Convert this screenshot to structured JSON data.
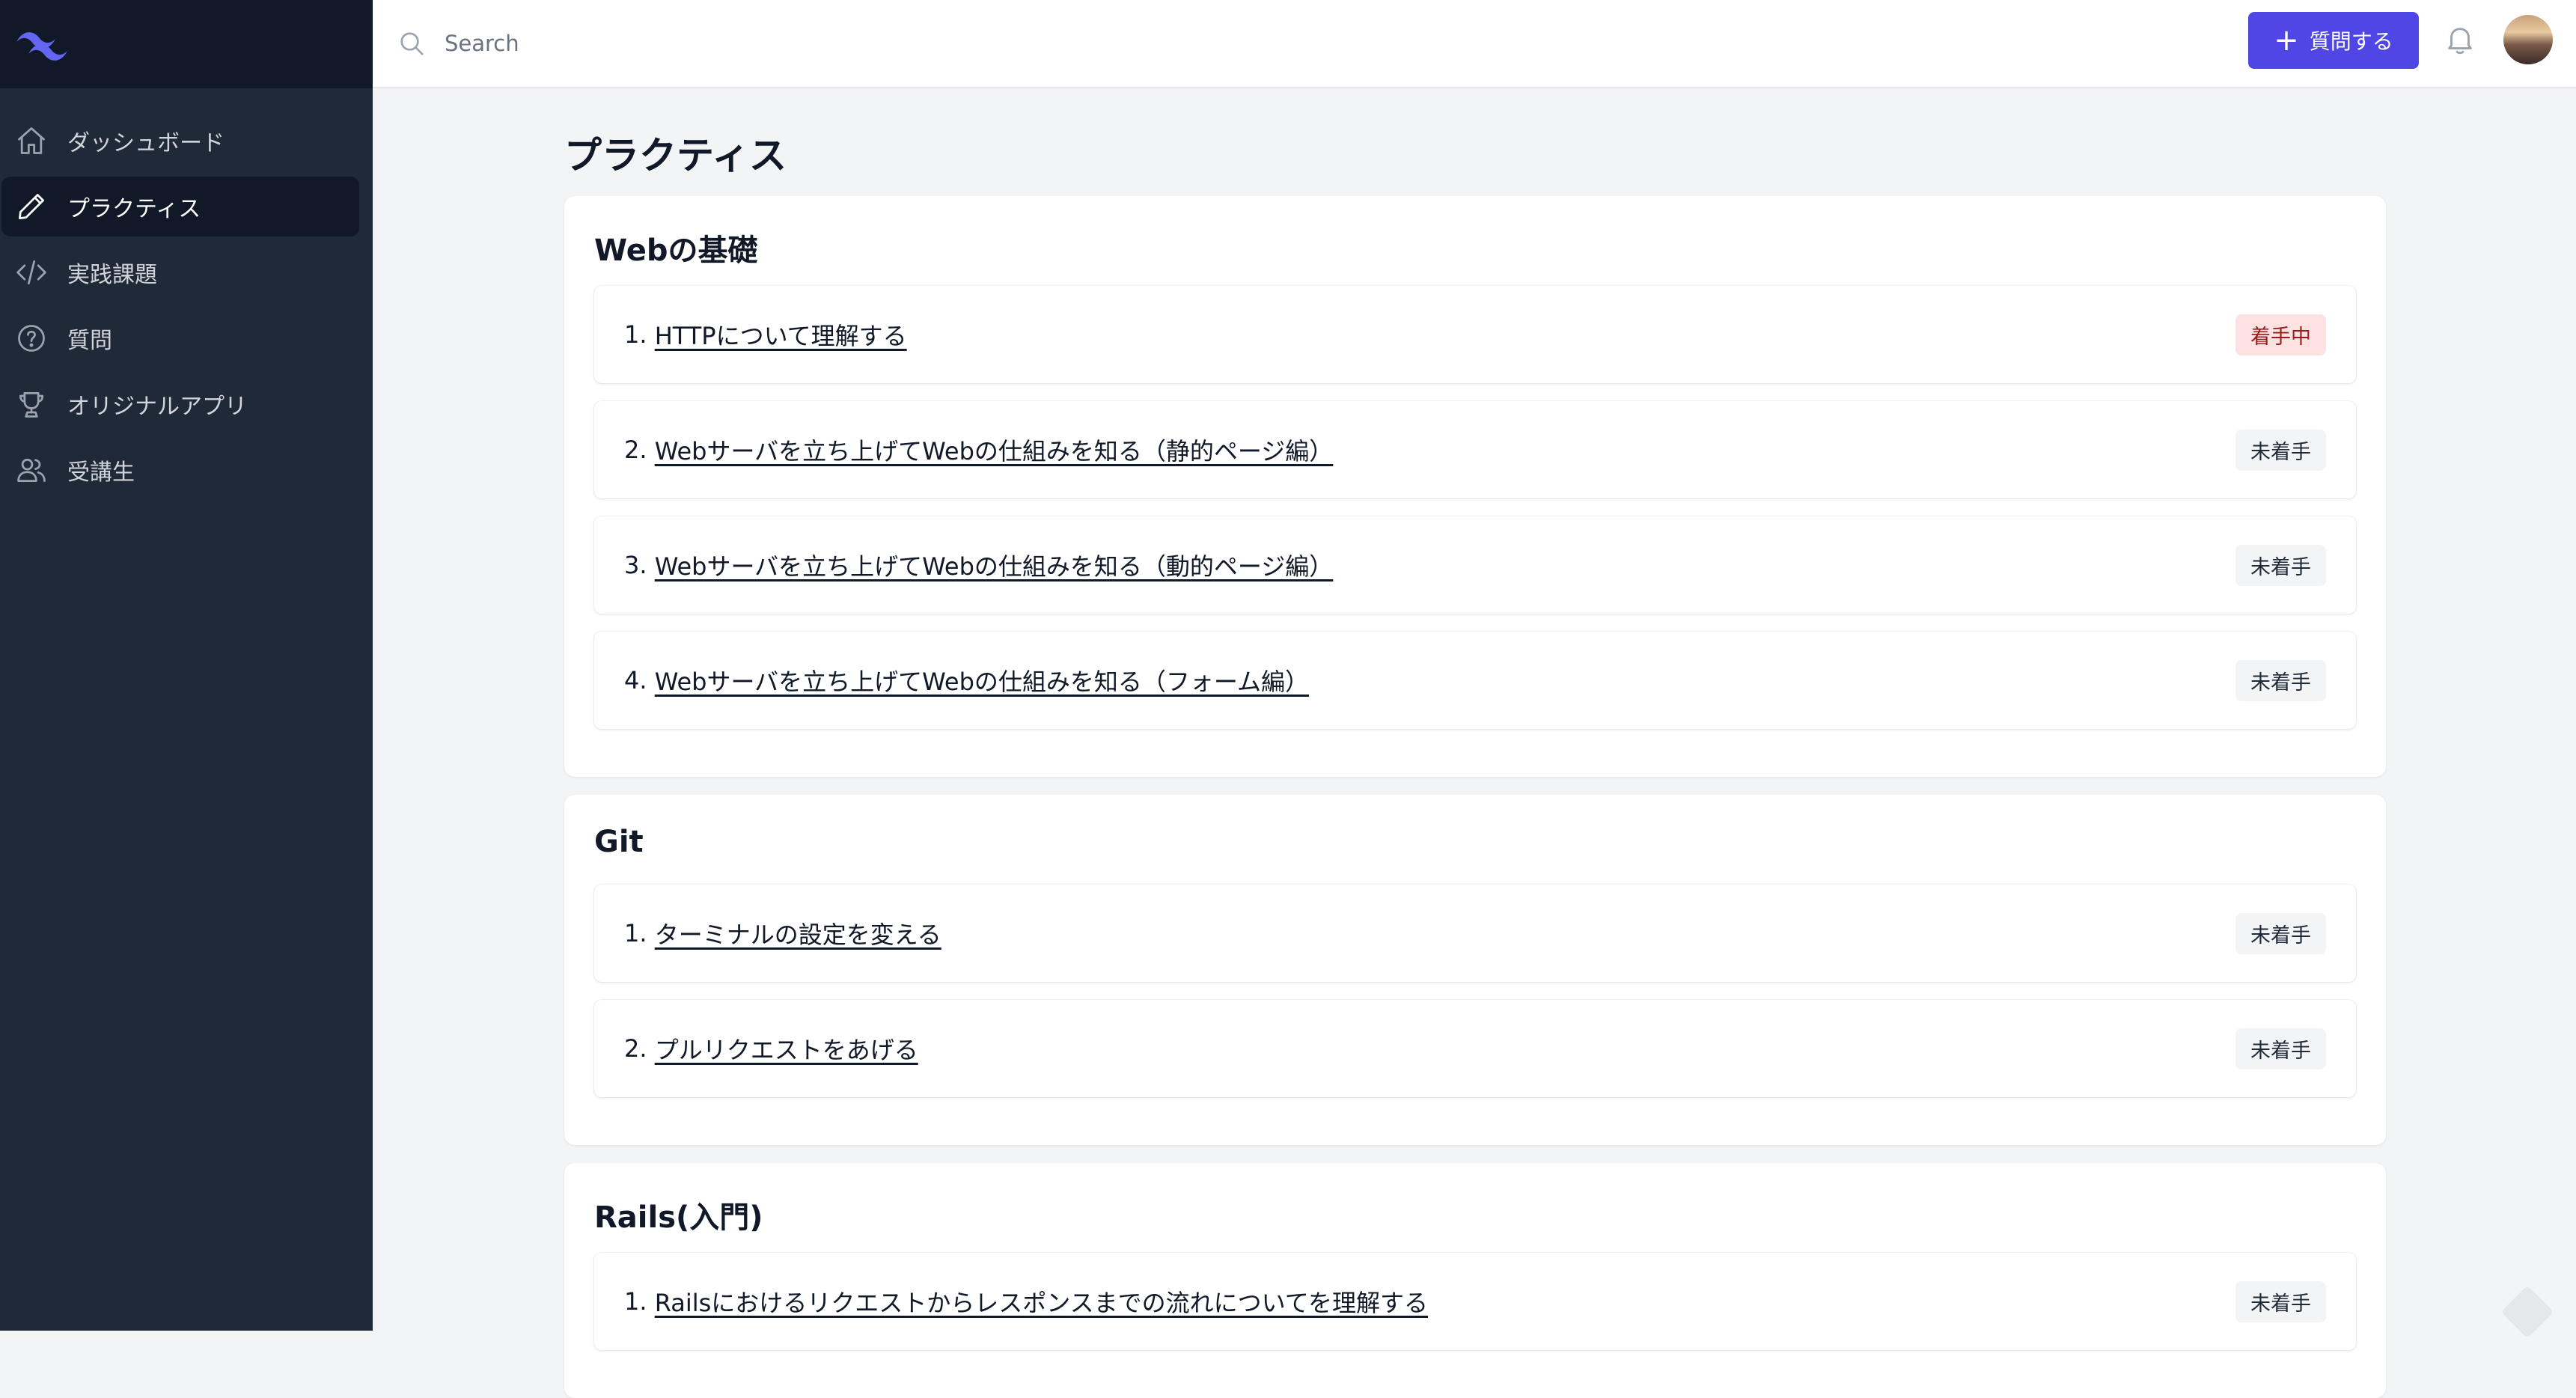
{
  "header": {
    "search_placeholder": "Search",
    "ask_button_label": "質問する"
  },
  "sidebar": {
    "items": [
      {
        "label": "ダッシュボード",
        "icon": "home-icon",
        "active": false
      },
      {
        "label": "プラクティス",
        "icon": "pencil-icon",
        "active": true
      },
      {
        "label": "実践課題",
        "icon": "code-icon",
        "active": false
      },
      {
        "label": "質問",
        "icon": "question-icon",
        "active": false
      },
      {
        "label": "オリジナルアプリ",
        "icon": "trophy-icon",
        "active": false
      },
      {
        "label": "受講生",
        "icon": "users-icon",
        "active": false
      }
    ]
  },
  "main": {
    "title": "プラクティス",
    "sections": [
      {
        "title": "Webの基礎",
        "items": [
          {
            "number": "1.",
            "label": "HTTPについて理解する",
            "status": "着手中"
          },
          {
            "number": "2.",
            "label": "Webサーバを立ち上げてWebの仕組みを知る（静的ページ編）",
            "status": "未着手"
          },
          {
            "number": "3.",
            "label": "Webサーバを立ち上げてWebの仕組みを知る（動的ページ編）",
            "status": "未着手"
          },
          {
            "number": "4.",
            "label": "Webサーバを立ち上げてWebの仕組みを知る（フォーム編）",
            "status": "未着手"
          }
        ]
      },
      {
        "title": "Git",
        "items": [
          {
            "number": "1.",
            "label": "ターミナルの設定を変える",
            "status": "未着手"
          },
          {
            "number": "2.",
            "label": "プルリクエストをあげる",
            "status": "未着手"
          }
        ]
      },
      {
        "title": "Rails(入門)",
        "items": [
          {
            "number": "1.",
            "label": "Railsにおけるリクエストからレスポンスまでの流れについてを理解する",
            "status": "未着手"
          }
        ]
      }
    ]
  },
  "colors": {
    "sidebar": "#1f2937",
    "sidebar_active": "#111827",
    "accent": "#4f46e5",
    "badge_doing_bg": "#fee2e2",
    "badge_doing_text": "#991b1b"
  }
}
